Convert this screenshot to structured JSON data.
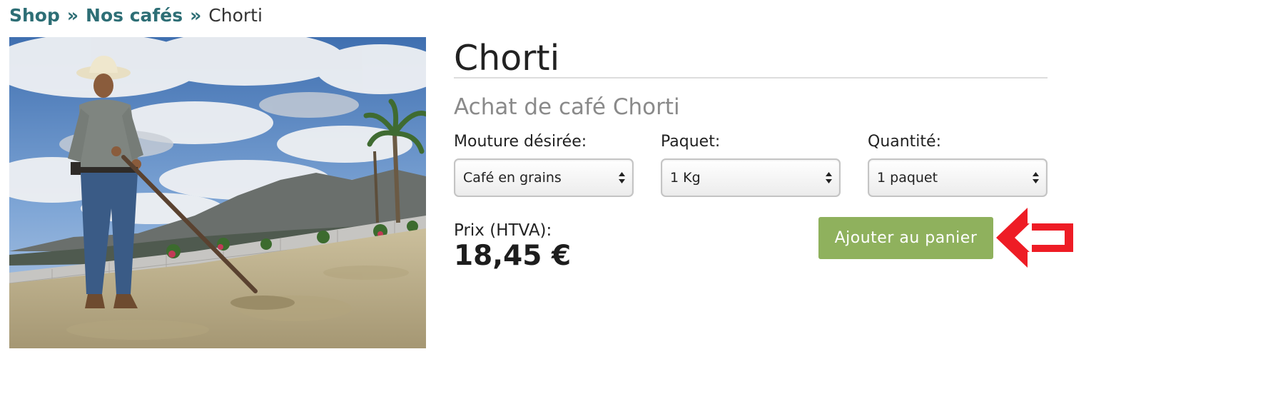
{
  "breadcrumb": {
    "items": [
      {
        "label": "Shop"
      },
      {
        "label": "Nos cafés"
      }
    ],
    "separator": "»",
    "current": "Chorti"
  },
  "product": {
    "title": "Chorti",
    "subtitle": "Achat de café Chorti",
    "image_icon": "coffee-drying-photo"
  },
  "options": {
    "mouture": {
      "label": "Mouture désirée:",
      "selected": "Café en grains"
    },
    "paquet": {
      "label": "Paquet:",
      "selected": "1 Kg"
    },
    "quantite": {
      "label": "Quantité:",
      "selected": "1 paquet"
    }
  },
  "price": {
    "label": "Prix (HTVA):",
    "value": "18,45 €"
  },
  "cart": {
    "button_label": "Ajouter au panier"
  },
  "colors": {
    "breadcrumb_link": "#2d6e75",
    "button_bg": "#8fb15d",
    "annotation_arrow": "#ee1c25"
  }
}
